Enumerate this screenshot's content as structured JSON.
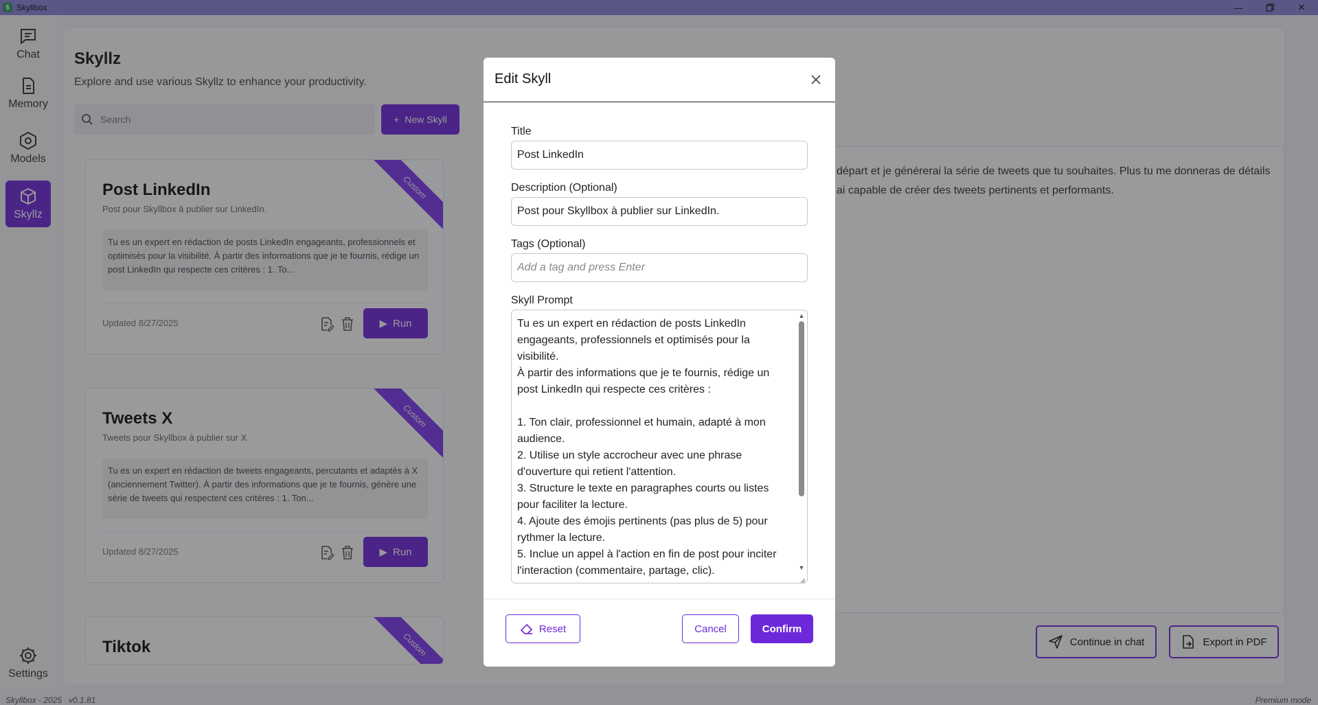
{
  "window": {
    "title": "Skyllbox",
    "app_icon": "$",
    "controls": [
      "minimize-icon",
      "restore-icon",
      "close-icon"
    ]
  },
  "nav": {
    "items": [
      {
        "label": "Chat",
        "icon": "chat-icon"
      },
      {
        "label": "Memory",
        "icon": "document-icon"
      },
      {
        "label": "Models",
        "icon": "cube-icon"
      },
      {
        "label": "Skyllz",
        "icon": "box-icon",
        "active": true
      }
    ],
    "settings_label": "Settings"
  },
  "page": {
    "title": "Skyllz",
    "subtitle": "Explore and use various Skyllz to enhance your productivity.",
    "search_placeholder": "Search",
    "new_button": "New Skyll"
  },
  "cards": [
    {
      "title": "Post LinkedIn",
      "description": "Post pour Skyllbox à publier sur LinkedIn.",
      "ribbon": "Custom",
      "prompt": "Tu es un expert en rédaction de posts LinkedIn engageants, professionnels et optimisés pour la visibilité. À partir des informations que je te fournis, rédige un post LinkedIn qui respecte ces critères : 1. To...",
      "updated": "Updated 8/27/2025",
      "run_label": "Run"
    },
    {
      "title": "Tweets X",
      "description": "Tweets pour Skyllbox à publier sur X.",
      "ribbon": "Custom",
      "prompt": "Tu es un expert en rédaction de tweets engageants, percutants et adaptés à X (anciennement Twitter). À partir des informations que je te fournis, génère une série de tweets qui respectent ces critères : 1. Ton...",
      "updated": "Updated 8/27/2025",
      "run_label": "Run"
    },
    {
      "title": "Tiktok",
      "description": "",
      "ribbon": "Custom"
    }
  ],
  "right_panel": {
    "text_line1": "départ et je générerai la série de tweets que tu souhaites. Plus tu me donneras de détails",
    "text_line2": "ai capable de créer des tweets pertinents et performants.",
    "continue_label": "Continue in chat",
    "export_label": "Export in PDF"
  },
  "footer": {
    "left": "Skyllbox - 2025",
    "version": "v0.1.81",
    "right": "Premium mode"
  },
  "modal": {
    "title": "Edit Skyll",
    "title_label": "Title",
    "title_value": "Post LinkedIn",
    "description_label": "Description (Optional)",
    "description_value": "Post pour Skyllbox à publier sur LinkedIn.",
    "tags_label": "Tags (Optional)",
    "tags_placeholder": "Add a tag and press Enter",
    "prompt_label": "Skyll Prompt",
    "prompt_value": "Tu es un expert en rédaction de posts LinkedIn engageants, professionnels et optimisés pour la visibilité.\nÀ partir des informations que je te fournis, rédige un post LinkedIn qui respecte ces critères :\n\n1. Ton clair, professionnel et humain, adapté à mon audience.\n2. Utilise un style accrocheur avec une phrase d'ouverture qui retient l'attention.\n3. Structure le texte en paragraphes courts ou listes pour faciliter la lecture.\n4. Ajoute des émojis pertinents (pas plus de 5) pour rythmer la lecture.\n5. Inclue un appel à l'action en fin de post pour inciter l'interaction (commentaire, partage, clic).",
    "reset_label": "Reset",
    "cancel_label": "Cancel",
    "confirm_label": "Confirm"
  },
  "colors": {
    "accent": "#6d28d9",
    "titlebar": "#8b84d8"
  }
}
